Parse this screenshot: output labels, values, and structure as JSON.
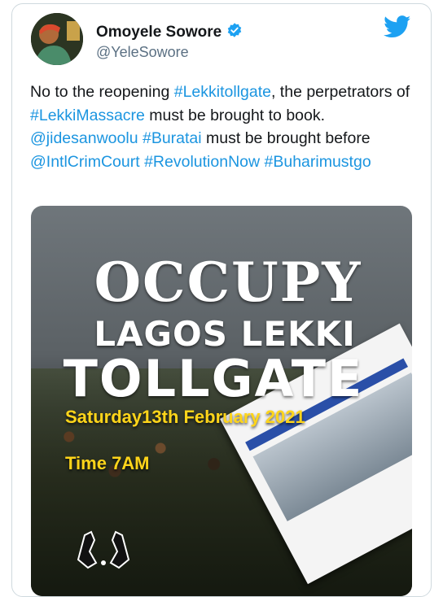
{
  "tweet": {
    "display_name": "Omoyele Sowore",
    "handle": "@YeleSowore",
    "verified": true,
    "icons": {
      "verified": "verified-badge-icon",
      "platform": "twitter-bird-icon"
    },
    "colors": {
      "link": "#1b95e0",
      "verified": "#1da1f2",
      "text": "#14171a",
      "secondary": "#5b7083"
    },
    "text_segments": [
      {
        "text": "No to the reopening ",
        "tag": false
      },
      {
        "text": "#Lekkitollgate",
        "tag": true
      },
      {
        "text": ", the perpetrators of ",
        "tag": false
      },
      {
        "text": "#LekkiMassacre",
        "tag": true
      },
      {
        "text": " must be  brought to book. ",
        "tag": false
      },
      {
        "text": "@jidesanwoolu",
        "tag": true
      },
      {
        "text": " ",
        "tag": false
      },
      {
        "text": "#Buratai",
        "tag": true
      },
      {
        "text": " must be brought before ",
        "tag": false
      },
      {
        "text": "@IntlCrimCourt",
        "tag": true
      },
      {
        "text": " ",
        "tag": false
      },
      {
        "text": "#RevolutionNow",
        "tag": true
      },
      {
        "text": " ",
        "tag": false
      },
      {
        "text": "#Buharimustgo",
        "tag": true
      }
    ]
  },
  "poster": {
    "line1": "OCCUPY",
    "line2": "LAGOS LEKKI",
    "line3": "TOLLGATE",
    "date": "Saturday13th February 2021",
    "time": "Time 7AM",
    "colors": {
      "headline": "#ffffff",
      "info": "#ffd51a"
    }
  }
}
